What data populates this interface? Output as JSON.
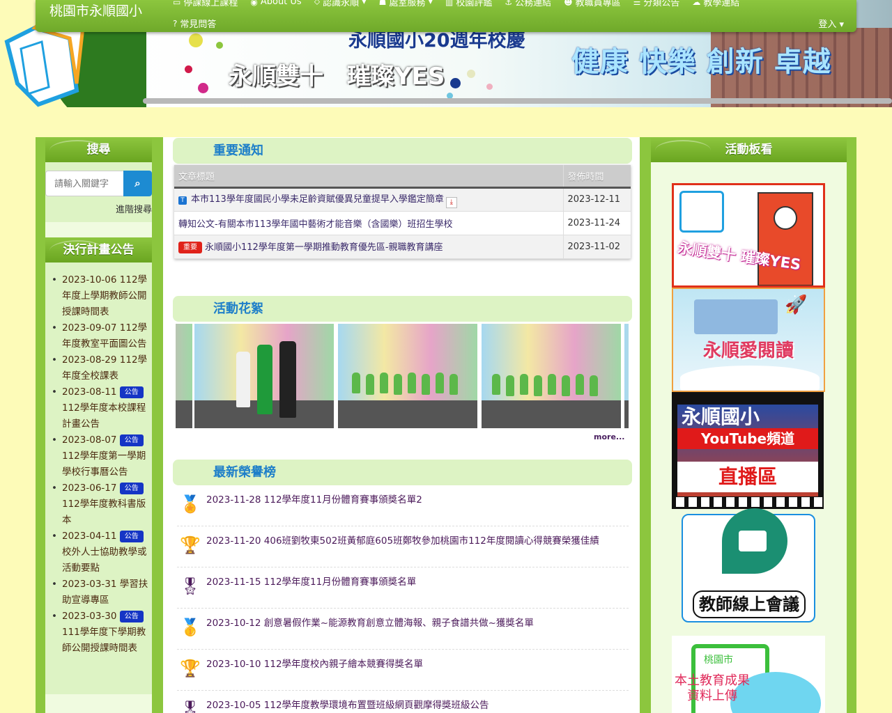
{
  "site": {
    "title": "桃園市永順國小"
  },
  "banner": {
    "anniversary": "永順國小20週年校慶",
    "slogan": "永順雙十　璀璨YES",
    "motto": "健康 快樂 創新 卓越"
  },
  "nav": {
    "row1": [
      {
        "icon": "laptop-icon",
        "glyph": "▭",
        "label": "停課線上課程",
        "caret": false
      },
      {
        "icon": "globe-icon",
        "glyph": "◉",
        "label": "About Us",
        "caret": false
      },
      {
        "icon": "map-marker-icon",
        "glyph": "⬦",
        "label": "認識永順",
        "caret": true
      },
      {
        "icon": "user-icon",
        "glyph": "☗",
        "label": "處室服務",
        "caret": true
      },
      {
        "icon": "bar-chart-icon",
        "glyph": "▥",
        "label": "校園評鑑",
        "caret": false
      },
      {
        "icon": "anchor-icon",
        "glyph": "⚓",
        "label": "公務連結",
        "caret": false
      },
      {
        "icon": "smile-icon",
        "glyph": "☻",
        "label": "教職員專區",
        "caret": false
      },
      {
        "icon": "list-icon",
        "glyph": "☰",
        "label": "分類公告",
        "caret": false
      },
      {
        "icon": "cloud-icon",
        "glyph": "☁",
        "label": "教學連結",
        "caret": false
      }
    ],
    "row2": [
      {
        "icon": "question-icon",
        "glyph": "?",
        "label": "常見問答",
        "caret": false
      }
    ],
    "login": "登入"
  },
  "search": {
    "heading": "搜尋",
    "placeholder": "請輸入關鍵字",
    "advanced": "進階搜尋"
  },
  "plans": {
    "heading": "決行計畫公告",
    "items": [
      {
        "date": "2023-10-06",
        "tag": "",
        "title": "112學年度上學期教師公開授課時間表"
      },
      {
        "date": "2023-09-07",
        "tag": "",
        "title": "112學年度教室平面圖公告"
      },
      {
        "date": "2023-08-29",
        "tag": "",
        "title": "112學年度全校課表"
      },
      {
        "date": "2023-08-11",
        "tag": "公告",
        "title": "112學年度本校課程計畫公告"
      },
      {
        "date": "2023-08-07",
        "tag": "公告",
        "title": "112學年度第一學期學校行事曆公告"
      },
      {
        "date": "2023-06-17",
        "tag": "公告",
        "title": "112學年度教科書版本"
      },
      {
        "date": "2023-04-11",
        "tag": "公告",
        "title": "校外人士協助教學或活動要點"
      },
      {
        "date": "2023-03-31",
        "tag": "",
        "title": "學習扶助宣導專區"
      },
      {
        "date": "2023-03-30",
        "tag": "公告",
        "title": "111學年度下學期教師公開授課時間表"
      }
    ]
  },
  "notices": {
    "heading": "重要通知",
    "col_title": "文章標題",
    "col_date": "發佈時間",
    "rows": [
      {
        "badge": "",
        "title": "本市113學年度國民小學未足齡資賦優異兒童提早入學鑑定簡章",
        "date": "2023-12-11"
      },
      {
        "badge": "",
        "title": "轉知公文-有關本市113學年國中藝術才能音樂（含國樂）班招生學校",
        "date": "2023-11-24"
      },
      {
        "badge": "重要",
        "title": "永順國小112學年度第一學期推動教育優先區-親職教育講座",
        "date": "2023-11-02"
      }
    ]
  },
  "gallery": {
    "heading": "活動花絮",
    "more": "more..."
  },
  "awards": {
    "heading": "最新榮譽榜",
    "items": [
      {
        "icon": "trophy-person-icon",
        "glyph": "🏅",
        "date": "2023-11-28",
        "title": "112學年度11月份體育賽事頒獎名單2"
      },
      {
        "icon": "trophy-cup-icon",
        "glyph": "🏆",
        "date": "2023-11-20",
        "title": "406班劉牧東502班黃郁庭605班鄭牧參加桃園市112年度閱讀心得競賽榮獲佳績"
      },
      {
        "icon": "medal-icon",
        "glyph": "🎖",
        "date": "2023-11-15",
        "title": "112學年度11月份體育賽事頒獎名單"
      },
      {
        "icon": "award-badge-icon",
        "glyph": "🥇",
        "date": "2023-10-12",
        "title": "創意暑假作業~能源教育創意立體海報、親子食譜共做~獲獎名單"
      },
      {
        "icon": "star-trophy-icon",
        "glyph": "🏆",
        "date": "2023-10-10",
        "title": "112學年度校內親子繪本競賽得獎名單"
      },
      {
        "icon": "ribbon-medal-icon",
        "glyph": "🎖",
        "date": "2023-10-05",
        "title": "112學年度教學環境布置暨班級網頁觀摩得獎班級公告"
      }
    ]
  },
  "board": {
    "heading": "活動板看",
    "promos": [
      {
        "name": "anniversary-promo",
        "text": "永順雙十 璀璨YES"
      },
      {
        "name": "reading-promo",
        "text": "永順愛閱讀"
      },
      {
        "name": "youtube-promo",
        "line1": "永順國小",
        "line2": "YouTube頻道",
        "line3": "直播區"
      },
      {
        "name": "meet-promo",
        "text": "教師線上會議"
      },
      {
        "name": "upload-promo",
        "line1": "桃園市",
        "line2": "本土教育成果",
        "line3": "資料上傳"
      }
    ]
  }
}
